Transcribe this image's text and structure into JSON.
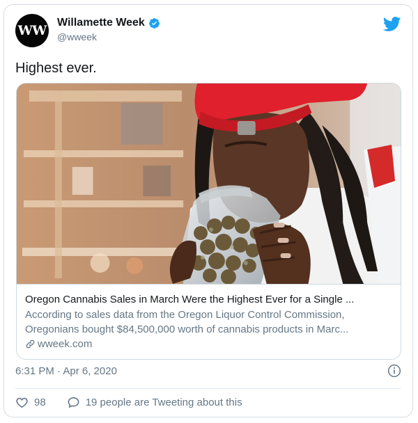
{
  "account": {
    "avatar_text": "WW",
    "name": "Willamette Week",
    "handle": "@wweek"
  },
  "tweet": {
    "text": "Highest ever."
  },
  "link_card": {
    "title": "Oregon Cannabis Sales in March Were the Highest Ever for a Single ...",
    "description_line1": "According to sales data from the Oregon Liquor Control Commission,",
    "description_line2": "Oregonians bought $84,500,000 worth of cannabis products in Marc...",
    "domain": "wweek.com",
    "image_description": "man smelling a jar of cannabis"
  },
  "meta": {
    "timestamp": "6:31 PM · Apr 6, 2020"
  },
  "actions": {
    "likes": "98",
    "conversation": "19 people are Tweeting about this"
  },
  "colors": {
    "twitter_blue": "#1da1f2",
    "text": "#14171a",
    "secondary_text": "#657786",
    "cap_red": "#e0202c"
  },
  "icons": [
    "verified-badge-icon",
    "twitter-bird-icon",
    "link-icon",
    "info-icon",
    "heart-icon",
    "speech-bubble-icon"
  ]
}
